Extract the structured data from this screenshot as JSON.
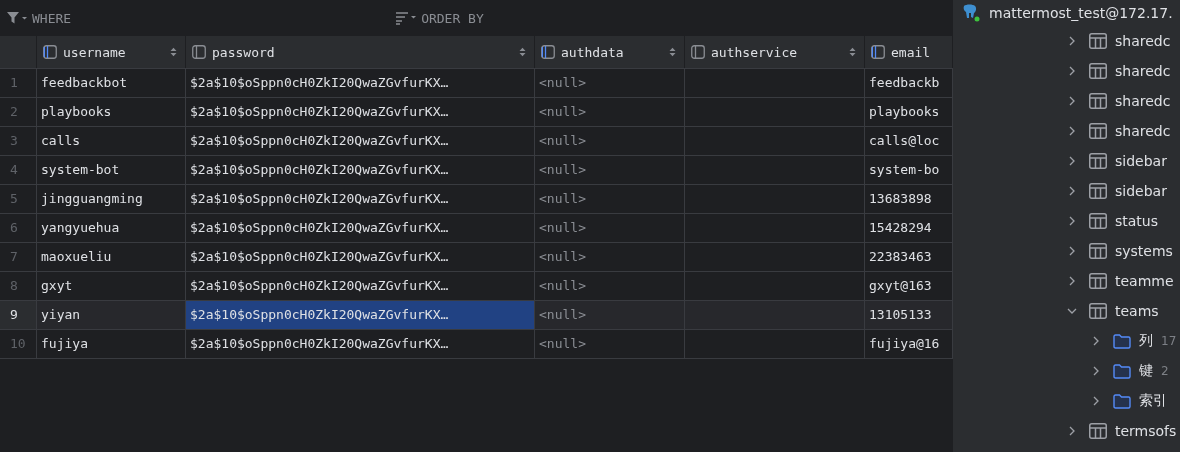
{
  "toolbar": {
    "filter_label": "WHERE",
    "order_label": "ORDER BY"
  },
  "table": {
    "columns": [
      {
        "name": "username",
        "indexed": true,
        "sort_icon": true
      },
      {
        "name": "password",
        "indexed": false,
        "sort_icon": true
      },
      {
        "name": "authdata",
        "indexed": true,
        "sort_icon": true
      },
      {
        "name": "authservice",
        "indexed": false,
        "sort_icon": true
      },
      {
        "name": "email",
        "indexed": true,
        "sort_icon": false
      }
    ],
    "rows": [
      {
        "num": "1",
        "selected": false,
        "cells": [
          {
            "kind": "text",
            "text": "feedbackbot",
            "selected": false
          },
          {
            "kind": "text",
            "text": "$2a$10$oSppn0cH0ZkI20QwaZGvfurKX…",
            "selected": false
          },
          {
            "kind": "null",
            "text": "<null>",
            "selected": false
          },
          {
            "kind": "empty",
            "selected": false
          },
          {
            "kind": "text",
            "text": "feedbackb",
            "selected": false
          }
        ]
      },
      {
        "num": "2",
        "selected": false,
        "cells": [
          {
            "kind": "text",
            "text": "playbooks",
            "selected": false
          },
          {
            "kind": "text",
            "text": "$2a$10$oSppn0cH0ZkI20QwaZGvfurKX…",
            "selected": false
          },
          {
            "kind": "null",
            "text": "<null>",
            "selected": false
          },
          {
            "kind": "empty",
            "selected": false
          },
          {
            "kind": "text",
            "text": "playbooks",
            "selected": false
          }
        ]
      },
      {
        "num": "3",
        "selected": false,
        "cells": [
          {
            "kind": "text",
            "text": "calls",
            "selected": false
          },
          {
            "kind": "text",
            "text": "$2a$10$oSppn0cH0ZkI20QwaZGvfurKX…",
            "selected": false
          },
          {
            "kind": "null",
            "text": "<null>",
            "selected": false
          },
          {
            "kind": "empty",
            "selected": false
          },
          {
            "kind": "text",
            "text": "calls@loc",
            "selected": false
          }
        ]
      },
      {
        "num": "4",
        "selected": false,
        "cells": [
          {
            "kind": "text",
            "text": "system-bot",
            "selected": false
          },
          {
            "kind": "text",
            "text": "$2a$10$oSppn0cH0ZkI20QwaZGvfurKX…",
            "selected": false
          },
          {
            "kind": "null",
            "text": "<null>",
            "selected": false
          },
          {
            "kind": "empty",
            "selected": false
          },
          {
            "kind": "text",
            "text": "system-bo",
            "selected": false
          }
        ]
      },
      {
        "num": "5",
        "selected": false,
        "cells": [
          {
            "kind": "text",
            "text": "jingguangming",
            "selected": false
          },
          {
            "kind": "text",
            "text": "$2a$10$oSppn0cH0ZkI20QwaZGvfurKX…",
            "selected": false
          },
          {
            "kind": "null",
            "text": "<null>",
            "selected": false
          },
          {
            "kind": "empty",
            "selected": false
          },
          {
            "kind": "text",
            "text": "13683898",
            "selected": false
          }
        ]
      },
      {
        "num": "6",
        "selected": false,
        "cells": [
          {
            "kind": "text",
            "text": "yangyuehua",
            "selected": false
          },
          {
            "kind": "text",
            "text": "$2a$10$oSppn0cH0ZkI20QwaZGvfurKX…",
            "selected": false
          },
          {
            "kind": "null",
            "text": "<null>",
            "selected": false
          },
          {
            "kind": "empty",
            "selected": false
          },
          {
            "kind": "text",
            "text": "15428294",
            "selected": false
          }
        ]
      },
      {
        "num": "7",
        "selected": false,
        "cells": [
          {
            "kind": "text",
            "text": "maoxueliu",
            "selected": false
          },
          {
            "kind": "text",
            "text": "$2a$10$oSppn0cH0ZkI20QwaZGvfurKX…",
            "selected": false
          },
          {
            "kind": "null",
            "text": "<null>",
            "selected": false
          },
          {
            "kind": "empty",
            "selected": false
          },
          {
            "kind": "text",
            "text": "22383463",
            "selected": false
          }
        ]
      },
      {
        "num": "8",
        "selected": false,
        "cells": [
          {
            "kind": "text",
            "text": "gxyt",
            "selected": false
          },
          {
            "kind": "text",
            "text": "$2a$10$oSppn0cH0ZkI20QwaZGvfurKX…",
            "selected": false
          },
          {
            "kind": "null",
            "text": "<null>",
            "selected": false
          },
          {
            "kind": "empty",
            "selected": false
          },
          {
            "kind": "text",
            "text": "gxyt@163",
            "selected": false
          }
        ]
      },
      {
        "num": "9",
        "selected": true,
        "cells": [
          {
            "kind": "text",
            "text": "yiyan",
            "selected": false
          },
          {
            "kind": "text",
            "text": "$2a$10$oSppn0cH0ZkI20QwaZGvfurKX…",
            "selected": true
          },
          {
            "kind": "null",
            "text": "<null>",
            "selected": false
          },
          {
            "kind": "empty",
            "selected": false
          },
          {
            "kind": "text",
            "text": "13105133",
            "selected": false
          }
        ]
      },
      {
        "num": "10",
        "selected": false,
        "cells": [
          {
            "kind": "text",
            "text": "fujiya",
            "selected": false
          },
          {
            "kind": "text",
            "text": "$2a$10$oSppn0cH0ZkI20QwaZGvfurKX…",
            "selected": false
          },
          {
            "kind": "null",
            "text": "<null>",
            "selected": false
          },
          {
            "kind": "empty",
            "selected": false
          },
          {
            "kind": "text",
            "text": "fujiya@16",
            "selected": false
          }
        ]
      }
    ]
  },
  "tree": {
    "connection": "mattermost_test@172.17.",
    "items": [
      {
        "kind": "table",
        "label": "sharedc",
        "expanded": false
      },
      {
        "kind": "table",
        "label": "sharedc",
        "expanded": false
      },
      {
        "kind": "table",
        "label": "sharedc",
        "expanded": false
      },
      {
        "kind": "table",
        "label": "sharedc",
        "expanded": false
      },
      {
        "kind": "table",
        "label": "sidebar",
        "expanded": false
      },
      {
        "kind": "table",
        "label": "sidebar",
        "expanded": false
      },
      {
        "kind": "table",
        "label": "status",
        "expanded": false
      },
      {
        "kind": "table",
        "label": "systems",
        "expanded": false
      },
      {
        "kind": "table",
        "label": "teamme",
        "expanded": false
      },
      {
        "kind": "table",
        "label": "teams",
        "expanded": true,
        "children": [
          {
            "kind": "folder",
            "label": "列",
            "count": "17",
            "expanded": false
          },
          {
            "kind": "folder",
            "label": "键",
            "count": "2",
            "expanded": false
          },
          {
            "kind": "folder",
            "label": "索引",
            "expanded": false
          }
        ]
      },
      {
        "kind": "table",
        "label": "termsofs",
        "expanded": false
      }
    ]
  }
}
